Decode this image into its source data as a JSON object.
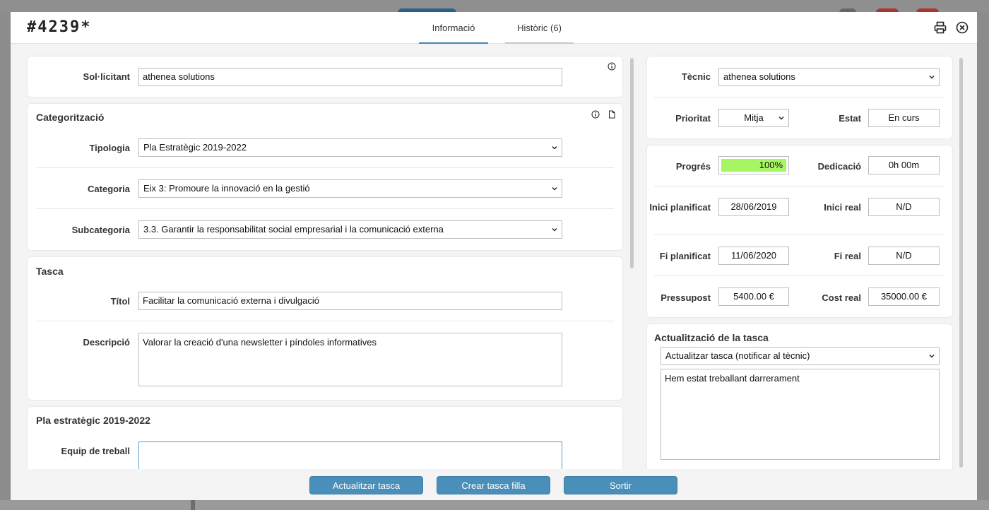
{
  "header": {
    "ticket_id": "#4239*",
    "tabs": [
      {
        "label": "Informació",
        "active": true
      },
      {
        "label": "Històric (6)",
        "active": false
      }
    ]
  },
  "requester": {
    "label": "Sol·licitant",
    "value": "athenea solutions"
  },
  "categorization": {
    "title": "Categorització",
    "typology_label": "Tipologia",
    "typology_value": "Pla Estratègic 2019-2022",
    "category_label": "Categoria",
    "category_value": "Eix 3: Promoure la innovació en la gestió",
    "subcategory_label": "Subcategoria",
    "subcategory_value": "3.3. Garantir la responsabilitat social empresarial i la comunicació externa"
  },
  "task": {
    "title": "Tasca",
    "title_label": "Títol",
    "title_value": "Facilitar la comunicació externa i divulgació",
    "description_label": "Descripció",
    "description_value": "Valorar la creació d'una newsletter i píndoles informatives"
  },
  "plan": {
    "title": "Pla estratègic 2019-2022",
    "team_label": "Equip de treball",
    "team_value": ""
  },
  "assignment": {
    "technician_label": "Tècnic",
    "technician_value": "athenea solutions",
    "priority_label": "Prioritat",
    "priority_value": "Mitja",
    "status_label": "Estat",
    "status_value": "En curs"
  },
  "tracking": {
    "progress_label": "Progrés",
    "progress_value": "100%",
    "progress_percent": 100,
    "dedication_label": "Dedicació",
    "dedication_value": "0h 00m",
    "planned_start_label": "Inici planificat",
    "planned_start_value": "28/06/2019",
    "real_start_label": "Inici real",
    "real_start_value": "N/D",
    "planned_end_label": "Fi planificat",
    "planned_end_value": "11/06/2020",
    "real_end_label": "Fi real",
    "real_end_value": "N/D",
    "budget_label": "Pressupost",
    "budget_value": "5400.00 €",
    "real_cost_label": "Cost real",
    "real_cost_value": "35000.00 €"
  },
  "update": {
    "title": "Actualització de la tasca",
    "mode_value": "Actualitzar tasca (notificar al tècnic)",
    "text_value": "Hem estat treballant darrerament"
  },
  "footer": {
    "update_button": "Actualitzar tasca",
    "child_button": "Crear tasca filla",
    "exit_button": "Sortir"
  },
  "colors": {
    "accent": "#4a8fba",
    "progress": "#a6f562"
  },
  "icons": {
    "print": "printer-icon",
    "close": "close-circle-icon",
    "info": "info-icon",
    "document": "document-icon"
  }
}
